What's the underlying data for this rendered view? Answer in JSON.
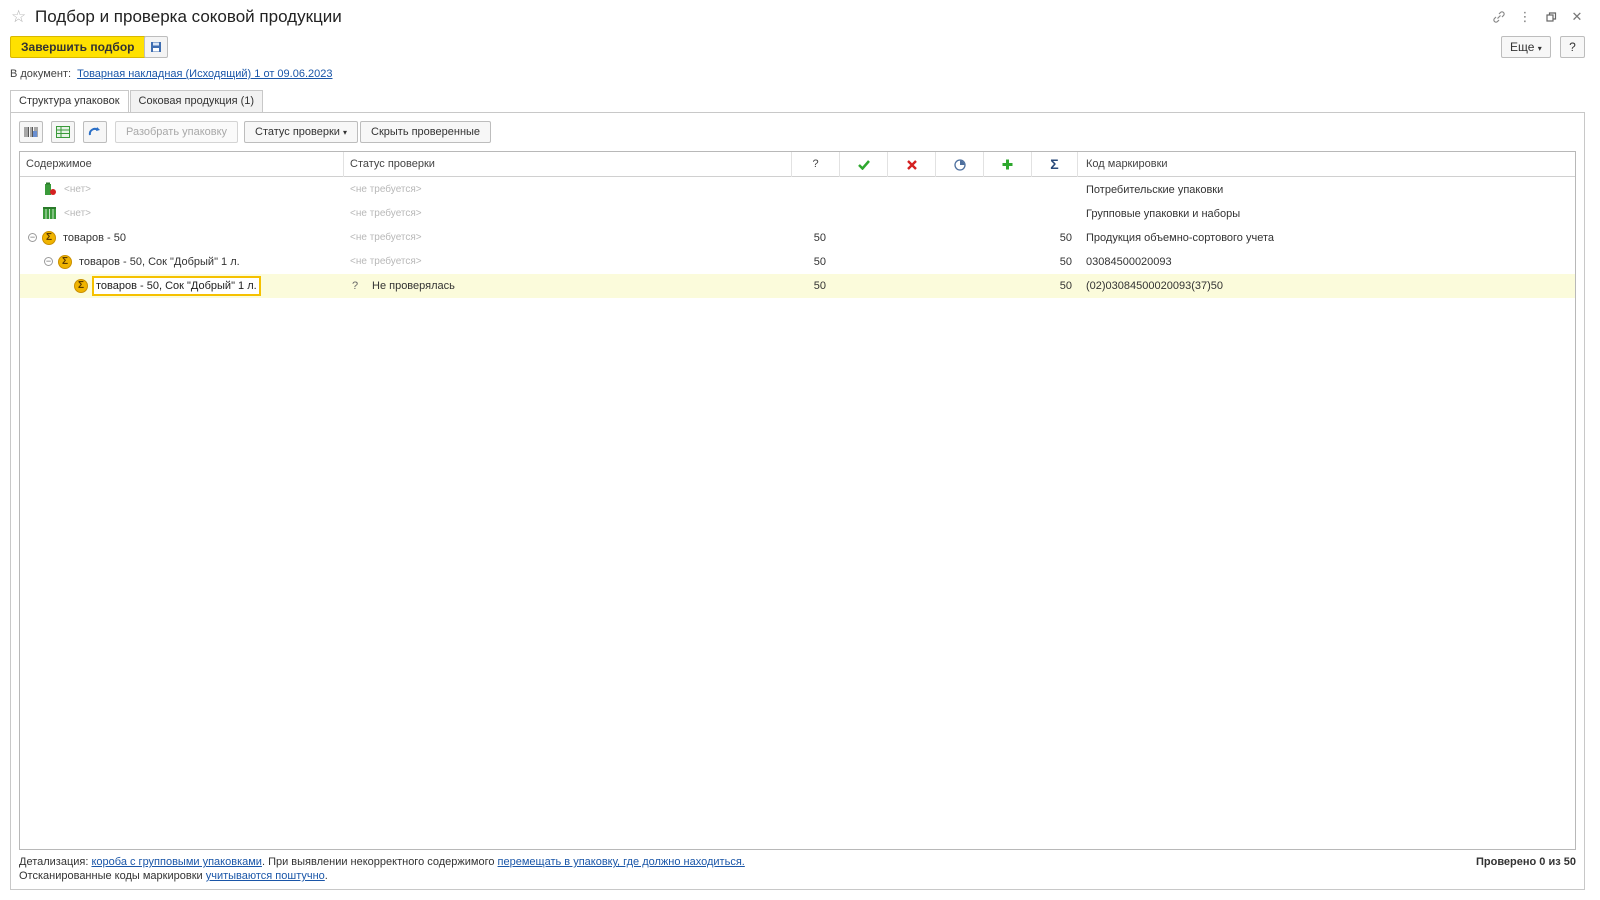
{
  "window": {
    "title": "Подбор и проверка соковой продукции",
    "icons": [
      "link-icon",
      "more-vertical-icon",
      "restore-window-icon",
      "close-icon"
    ]
  },
  "commands": {
    "finish_label": "Завершить подбор",
    "more_label": "Еще",
    "help_label": "?"
  },
  "document": {
    "prefix": "В документ:",
    "link": "Товарная накладная (Исходящий) 1 от 09.06.2023"
  },
  "tabs": [
    {
      "label": "Структура упаковок",
      "active": true
    },
    {
      "label": "Соковая продукция (1)",
      "active": false
    }
  ],
  "toolbar": {
    "unpack_label": "Разобрать упаковку",
    "status_label": "Статус проверки",
    "hide_checked_label": "Скрыть проверенные"
  },
  "grid": {
    "headers": {
      "content": "Содержимое",
      "status": "Статус проверки",
      "unknown": "?",
      "code": "Код маркировки"
    },
    "rows": [
      {
        "content": "<нет>",
        "status": "<не требуется>",
        "unknown": "",
        "total": "",
        "code": "Потребительские упаковки"
      },
      {
        "content": "<нет>",
        "status": "<не требуется>",
        "unknown": "",
        "total": "",
        "code": "Групповые упаковки и наборы"
      },
      {
        "content": "товаров - 50",
        "status": "<не требуется>",
        "unknown": "50",
        "total": "50",
        "code": "Продукция объемно-сортового учета"
      },
      {
        "content": "товаров - 50, Сок \"Добрый\" 1 л.",
        "status": "<не требуется>",
        "unknown": "50",
        "total": "50",
        "code": "03084500020093"
      },
      {
        "content": "товаров - 50, Сок \"Добрый\" 1 л.",
        "status_mark": "?",
        "status": "Не проверялась",
        "unknown": "50",
        "total": "50",
        "code": "(02)03084500020093(37)50"
      }
    ]
  },
  "footer": {
    "detail_prefix": "Детализация:",
    "detail_link": "короба с групповыми упаковками",
    "incorrect_text": ". При выявлении некорректного содержимого",
    "incorrect_link": "перемещать в упаковку, где должно находиться.",
    "scanned_prefix": "Отсканированные коды маркировки",
    "scanned_link": "учитываются поштучно",
    "scanned_suffix": ".",
    "checked": "Проверено 0 из 50"
  },
  "colors": {
    "accent": "#ffe100",
    "link": "#1a56a8",
    "selected_row": "#fbfbdb",
    "ok": "#2ea82e",
    "error": "#d42020",
    "sigma": "#f0b400"
  }
}
